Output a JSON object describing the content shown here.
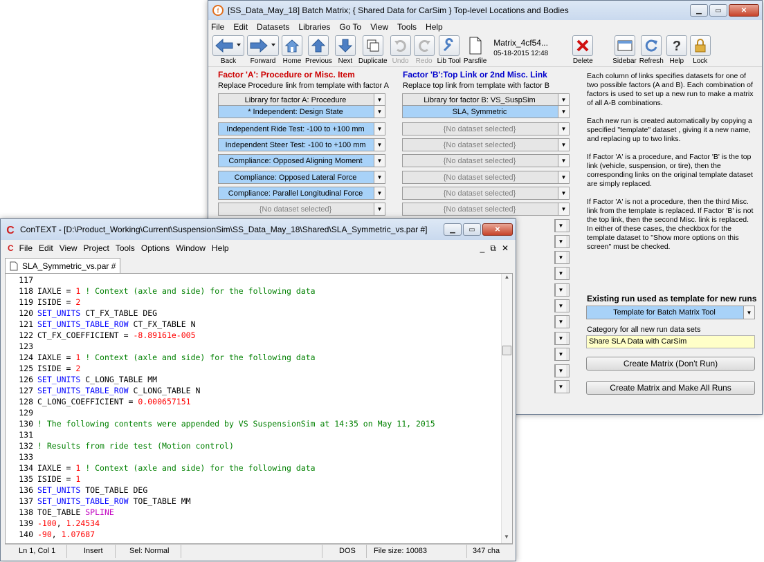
{
  "batch": {
    "title": "[SS_Data_May_18] Batch Matrix; { Shared Data for CarSim } Top-level Locations and Bodies",
    "menu": [
      "File",
      "Edit",
      "Datasets",
      "Libraries",
      "Go To",
      "View",
      "Tools",
      "Help"
    ],
    "toolbar": {
      "back": "Back",
      "forward": "Forward",
      "home": "Home",
      "previous": "Previous",
      "next": "Next",
      "duplicate": "Duplicate",
      "undo": "Undo",
      "redo": "Redo",
      "libtool": "Lib Tool",
      "parsfile": "Parsfile",
      "dataset_name": "Matrix_4cf54...",
      "dataset_date": "05-18-2015 12:48",
      "delete": "Delete",
      "sidebar": "Sidebar",
      "refresh": "Refresh",
      "help": "Help",
      "lock": "Lock"
    },
    "factorA": {
      "heading": "Factor 'A': Procedure or Misc. Item",
      "desc": "Replace Procedure link from template with factor A",
      "library": "Library for factor A: Procedure",
      "items": [
        "* Independent: Design State",
        "Independent Ride Test: -100 to +100 mm",
        "Independent Steer Test: -100 to +100 mm",
        "Compliance: Opposed Aligning Moment",
        "Compliance: Opposed Lateral Force",
        "Compliance: Parallel Longitudinal Force",
        "{No dataset selected}"
      ]
    },
    "factorB": {
      "heading": "Factor 'B':Top Link or 2nd Misc. Link",
      "desc": "Replace top link from template with factor B",
      "library": "Library for factor B: VS_SuspSim",
      "items": [
        "SLA, Symmetric",
        "{No dataset selected}",
        "{No dataset selected}",
        "{No dataset selected}",
        "{No dataset selected}",
        "{No dataset selected}",
        "{No dataset selected}"
      ]
    },
    "info": {
      "p1": "Each column of links specifies datasets for  one of two possible factors (A and B). Each combination of factors is used to set up a new run to make a matrix of all A-B combinations.",
      "p2": "Each new run is created automatically by copying a specified \"template\" dataset , giving it a new name, and replacing up to two links.",
      "p3": "If Factor 'A' is a procedure, and Factor 'B' is the top link (vehicle, suspension, or tire), then the corresponding links on the original template dataset are simply replaced.",
      "p4": " If Factor 'A' is not a procedure, then the third Misc. link from the template is replaced. If Factor 'B' is not the top link, then the second Misc. link is replaced. In either of these cases, the checkbox for the template dataset to \"Show more options on this screen\" must be checked."
    },
    "template_heading": "Existing run used as template for new runs",
    "template_value": "Template for Batch Matrix Tool",
    "category_label": "Category for all new run data sets",
    "category_value": "Share SLA Data with CarSim",
    "create_btn": "Create Matrix (Don't Run)",
    "create_run_btn": "Create Matrix and Make All Runs"
  },
  "context": {
    "title": "ConTEXT - [D:\\Product_Working\\Current\\SuspensionSim\\SS_Data_May_18\\Shared\\SLA_Symmetric_vs.par #]",
    "menu": [
      "File",
      "Edit",
      "View",
      "Project",
      "Tools",
      "Options",
      "Window",
      "Help"
    ],
    "tab": "SLA_Symmetric_vs.par #",
    "lines": [
      {
        "n": "117",
        "t": []
      },
      {
        "n": "118",
        "t": [
          [
            "p",
            "IAXLE = "
          ],
          [
            "num",
            "1"
          ],
          [
            "cmt",
            " ! Context (axle and side) for the following data"
          ]
        ]
      },
      {
        "n": "119",
        "t": [
          [
            "p",
            "ISIDE = "
          ],
          [
            "num",
            "2"
          ]
        ]
      },
      {
        "n": "120",
        "t": [
          [
            "kw",
            "SET_UNITS"
          ],
          [
            "p",
            " CT_FX_TABLE DEG"
          ]
        ]
      },
      {
        "n": "121",
        "t": [
          [
            "kw",
            "SET_UNITS_TABLE_ROW"
          ],
          [
            "p",
            " CT_FX_TABLE N"
          ]
        ]
      },
      {
        "n": "122",
        "t": [
          [
            "p",
            "CT_FX_COEFFICIENT = "
          ],
          [
            "num",
            "-8.89161e-005"
          ]
        ]
      },
      {
        "n": "123",
        "t": []
      },
      {
        "n": "124",
        "t": [
          [
            "p",
            "IAXLE = "
          ],
          [
            "num",
            "1"
          ],
          [
            "cmt",
            " ! Context (axle and side) for the following data"
          ]
        ]
      },
      {
        "n": "125",
        "t": [
          [
            "p",
            "ISIDE = "
          ],
          [
            "num",
            "2"
          ]
        ]
      },
      {
        "n": "126",
        "t": [
          [
            "kw",
            "SET_UNITS"
          ],
          [
            "p",
            " C_LONG_TABLE MM"
          ]
        ]
      },
      {
        "n": "127",
        "t": [
          [
            "kw",
            "SET_UNITS_TABLE_ROW"
          ],
          [
            "p",
            " C_LONG_TABLE N"
          ]
        ]
      },
      {
        "n": "128",
        "t": [
          [
            "p",
            "C_LONG_COEFFICIENT = "
          ],
          [
            "num",
            "0.000657151"
          ]
        ]
      },
      {
        "n": "129",
        "t": []
      },
      {
        "n": "130",
        "t": [
          [
            "cmt",
            "! The following contents were appended by VS SuspensionSim at 14:35 on May 11, 2015"
          ]
        ]
      },
      {
        "n": "131",
        "t": []
      },
      {
        "n": "132",
        "t": [
          [
            "cmt",
            "! Results from ride test (Motion control)"
          ]
        ]
      },
      {
        "n": "133",
        "t": []
      },
      {
        "n": "134",
        "t": [
          [
            "p",
            "IAXLE = "
          ],
          [
            "num",
            "1"
          ],
          [
            "cmt",
            " ! Context (axle and side) for the following data"
          ]
        ]
      },
      {
        "n": "135",
        "t": [
          [
            "p",
            "ISIDE = "
          ],
          [
            "num",
            "1"
          ]
        ]
      },
      {
        "n": "136",
        "t": [
          [
            "kw",
            "SET_UNITS"
          ],
          [
            "p",
            " TOE_TABLE DEG"
          ]
        ]
      },
      {
        "n": "137",
        "t": [
          [
            "kw",
            "SET_UNITS_TABLE_ROW"
          ],
          [
            "p",
            " TOE_TABLE MM"
          ]
        ]
      },
      {
        "n": "138",
        "t": [
          [
            "p",
            "TOE_TABLE "
          ],
          [
            "spl",
            "SPLINE"
          ]
        ]
      },
      {
        "n": "139",
        "t": [
          [
            "num",
            "-100"
          ],
          [
            "p",
            ", "
          ],
          [
            "num",
            "1.24534"
          ]
        ]
      },
      {
        "n": "140",
        "t": [
          [
            "num",
            "-90"
          ],
          [
            "p",
            ", "
          ],
          [
            "num",
            "1.07687"
          ]
        ]
      }
    ],
    "status": {
      "pos": "Ln 1, Col 1",
      "mode": "Insert",
      "sel": "Sel: Normal",
      "blank": "",
      "format": "DOS",
      "size": "File size: 10083",
      "chars": "347 cha"
    }
  },
  "colors": {
    "kw": "#0000ff",
    "num": "#ff0000",
    "cmt": "#008000",
    "spline": "#c000c0",
    "combo_selected": "#a8d2f8",
    "factorA_heading": "#cc0000",
    "factorB_heading": "#0000cc"
  }
}
